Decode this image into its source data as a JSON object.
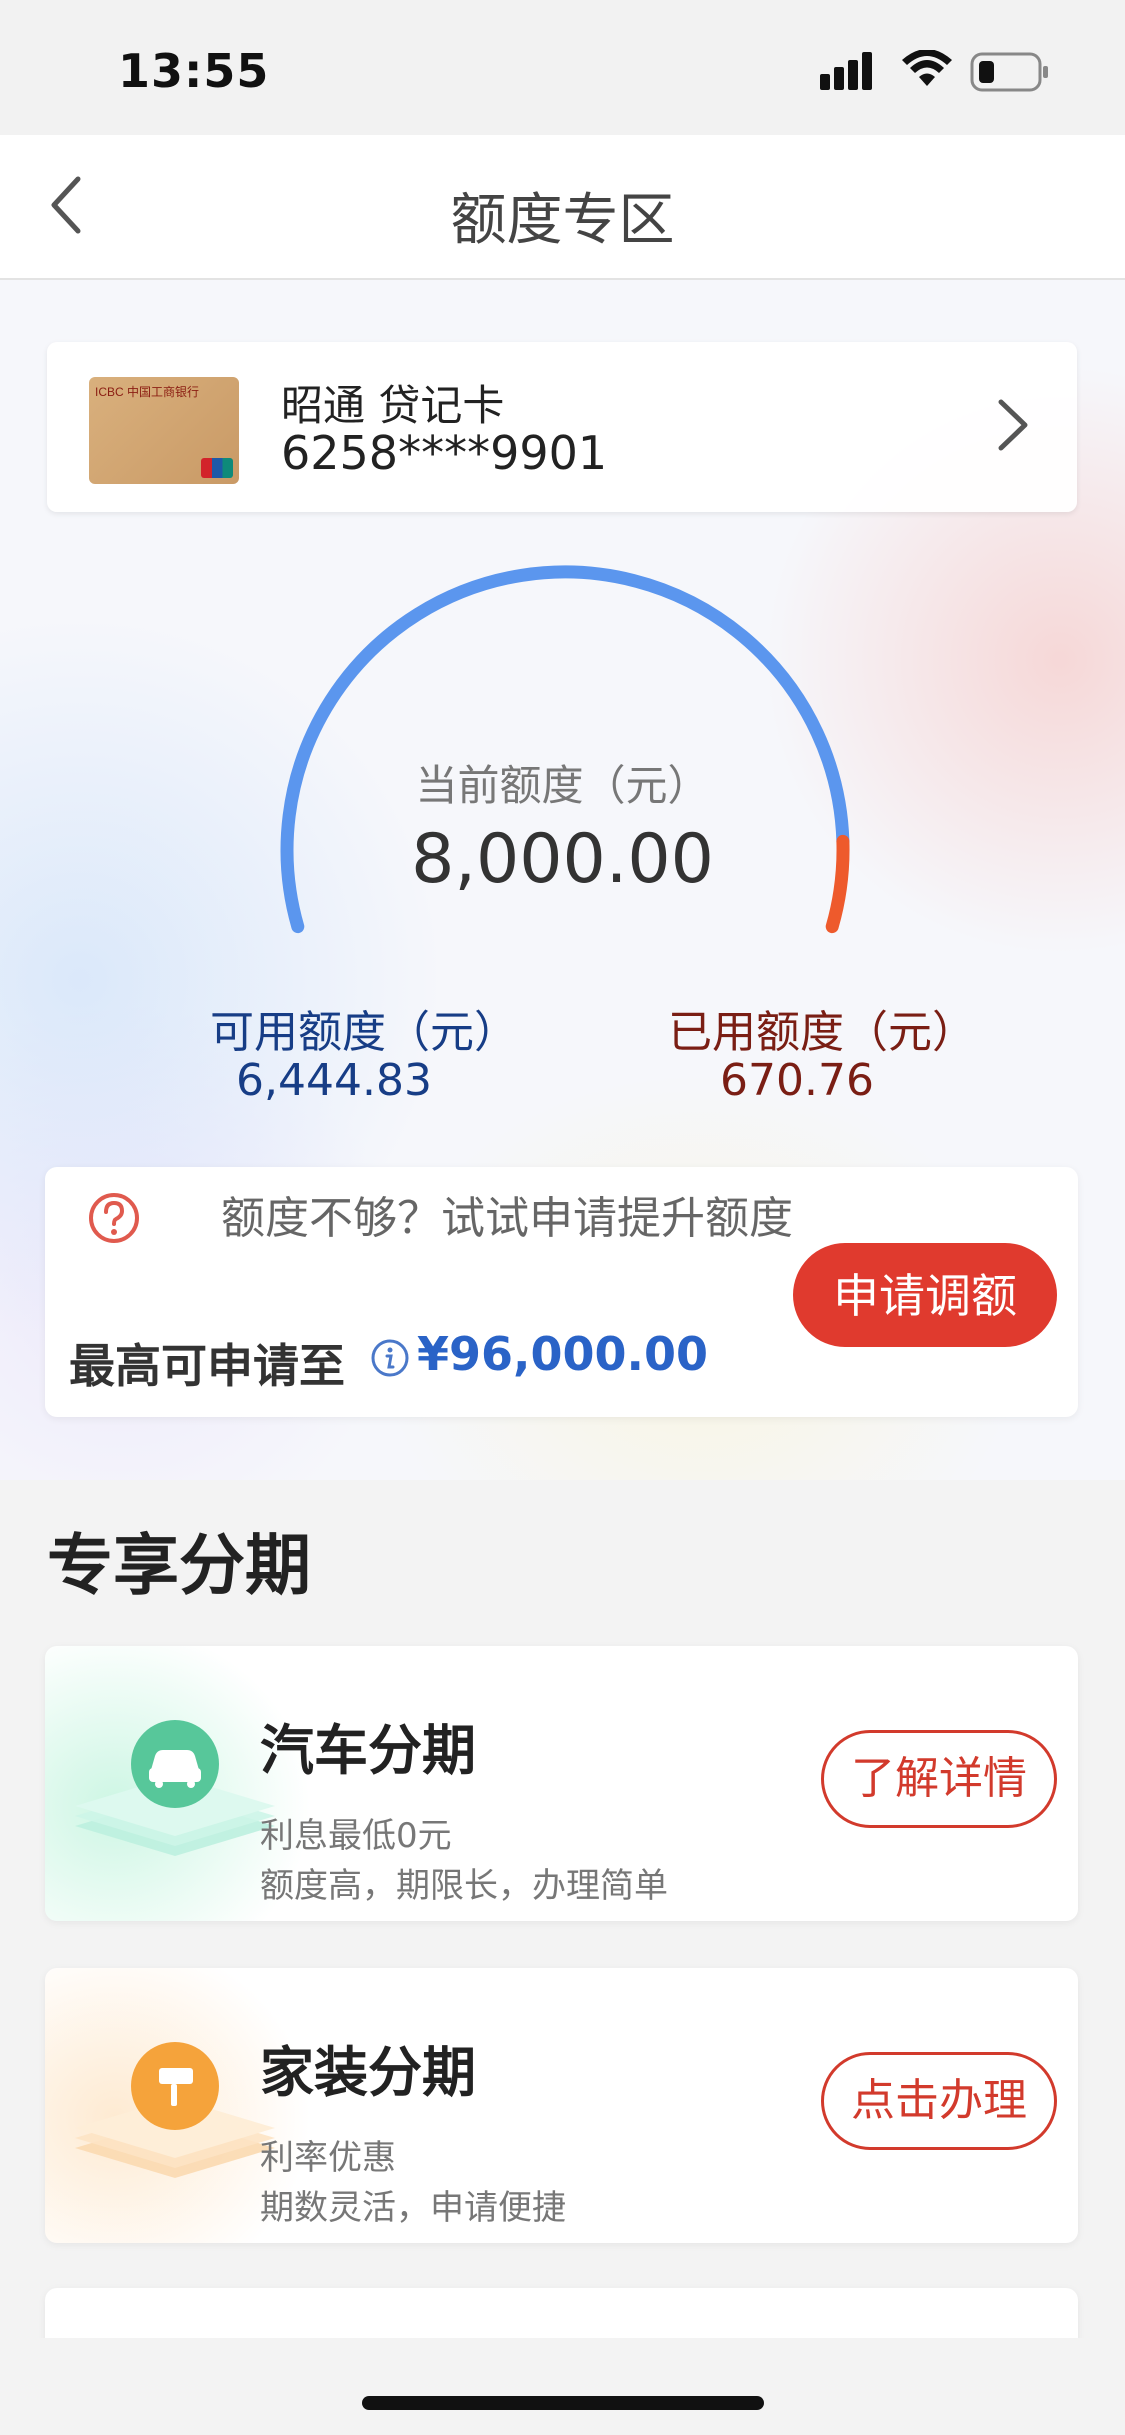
{
  "status_bar": {
    "time": "13:55"
  },
  "nav": {
    "title": "额度专区"
  },
  "card": {
    "name": "昭通 贷记卡",
    "number": "6258****9901",
    "thumb_text": "ICBC 中国工商银行"
  },
  "gauge": {
    "label": "当前额度（元）",
    "value": "8,000.00",
    "used_fraction": 0.0838
  },
  "available": {
    "label": "可用额度（元）",
    "value": "6,444.83"
  },
  "used": {
    "label": "已用额度（元）",
    "value": "670.76"
  },
  "raise": {
    "text": "额度不够？试试申请提升额度",
    "max_label": "最高可申请至",
    "max_value": "¥96,000.00",
    "apply_label": "申请调额"
  },
  "section": {
    "title": "专享分期",
    "items": [
      {
        "title": "汽车分期",
        "sub1": "利息最低0元",
        "sub2": "额度高，期限长，办理简单",
        "button": "了解详情",
        "icon": "car-icon"
      },
      {
        "title": "家装分期",
        "sub1": "利率优惠",
        "sub2": "期数灵活，申请便捷",
        "button": "点击办理",
        "icon": "paint-roller-icon"
      }
    ]
  },
  "colors": {
    "accent_red": "#e03a2e",
    "gauge_blue": "#5b96ee",
    "gauge_orange": "#ee5a2c",
    "available_blue": "#173d86",
    "used_brown": "#7a1e14",
    "max_blue": "#2a63c7"
  }
}
